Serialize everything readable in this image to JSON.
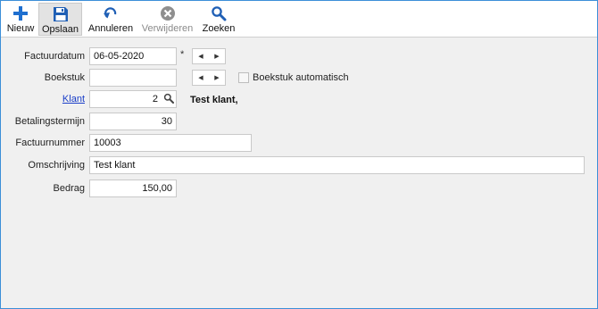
{
  "toolbar": {
    "buttons": [
      {
        "label": "Nieuw",
        "icon": "plus-icon"
      },
      {
        "label": "Opslaan",
        "icon": "save-icon"
      },
      {
        "label": "Annuleren",
        "icon": "undo-icon"
      },
      {
        "label": "Verwijderen",
        "icon": "delete-icon"
      },
      {
        "label": "Zoeken",
        "icon": "search-icon"
      }
    ]
  },
  "form": {
    "factuurdatum": {
      "label": "Factuurdatum",
      "value": "06-05-2020",
      "required_mark": "*"
    },
    "boekstuk": {
      "label": "Boekstuk",
      "value": "",
      "auto_label": "Boekstuk automatisch",
      "auto_checked": false
    },
    "klant": {
      "label": "Klant",
      "value": "2",
      "name": "Test klant,"
    },
    "betalingstermijn": {
      "label": "Betalingstermijn",
      "value": "30"
    },
    "factuurnummer": {
      "label": "Factuurnummer",
      "value": "10003"
    },
    "omschrijving": {
      "label": "Omschrijving",
      "value": "Test klant"
    },
    "bedrag": {
      "label": "Bedrag",
      "value": "150,00"
    }
  },
  "colors": {
    "accent": "#1f6fcf",
    "window_border": "#3c8fd8",
    "link": "#1a3ec8"
  }
}
